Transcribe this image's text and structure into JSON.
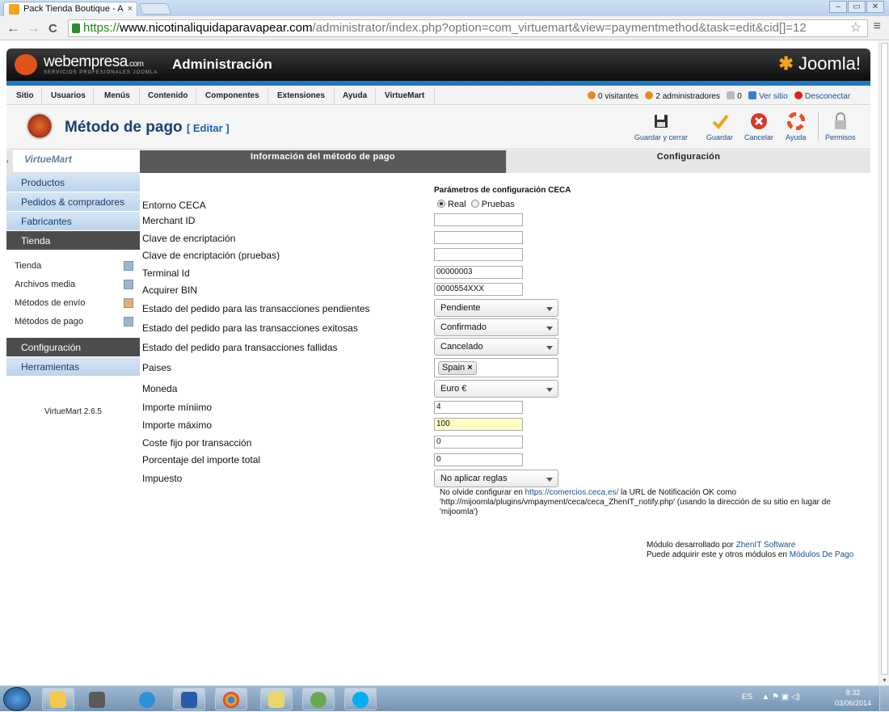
{
  "browser": {
    "tab_title": "Pack Tienda Boutique - A",
    "tab_close": "×",
    "url_scheme": "https://",
    "url_host": "www.nicotinaliquidaparavapear.com",
    "url_path": "/administrator/index.php?option=com_virtuemart&view=paymentmethod&task=edit&cid[]=12",
    "back": "←",
    "forward": "→",
    "reload": "C",
    "star": "☆",
    "menu": "≡",
    "win_min": "–",
    "win_max": "▭",
    "win_close": "✕"
  },
  "header": {
    "brand": "webempresa",
    "brand_suffix": ".com",
    "brand_sub": "SERVICIOS PROFESIONALES JOOMLA",
    "title": "Administración",
    "joomla_logo": "Joomla!"
  },
  "topmenu": {
    "items": [
      "Sitio",
      "Usuarios",
      "Menús",
      "Contenido",
      "Componentes",
      "Extensiones",
      "Ayuda",
      "VirtueMart"
    ],
    "visitors": "0 visitantes",
    "admins": "2 administradores",
    "messages": "0",
    "view_site": "Ver sitio",
    "logout": "Desconectar"
  },
  "toolbar": {
    "page_title": "Método de pago",
    "page_subtitle": "[ Editar ]",
    "buttons": [
      "Guardar y cerrar",
      "Guardar",
      "Cancelar",
      "Ayuda",
      "Permisos"
    ]
  },
  "sidebar": {
    "logo": "VirtueMart",
    "collapse": "‹",
    "sections": [
      "Productos",
      "Pedidos & compradores",
      "Fabricantes",
      "Tienda"
    ],
    "subitems": [
      "Tienda",
      "Archivos media",
      "Métodos de envío",
      "Métodos de pago"
    ],
    "bottom": [
      "Configuración",
      "Herramientas"
    ],
    "version": "VirtueMart 2.6.5"
  },
  "tabs": {
    "info": "Información del método de pago",
    "config": "Configuración"
  },
  "form": {
    "section_title": "Parámetros de configuración CECA",
    "labels": {
      "entorno": "Entorno CECA",
      "merchant": "Merchant ID",
      "clave": "Clave de encriptación",
      "clave_pruebas": "Clave de encriptación (pruebas)",
      "terminal": "Terminal Id",
      "acquirer": "Acquirer BIN",
      "estado_pend": "Estado del pedido para las transacciones pendientes",
      "estado_exit": "Estado del pedido para las transacciones exitosas",
      "estado_fall": "Estado del pedido para transacciones fallidas",
      "paises": "Paises",
      "moneda": "Moneda",
      "importe_min": "Importe míniimo",
      "importe_max": "Importe máximo",
      "coste_fijo": "Coste fijo por transacción",
      "porcentaje": "Porcentaje del importe total",
      "impuesto": "Impuesto"
    },
    "radio_real": "Real",
    "radio_pruebas": "Pruebas",
    "values": {
      "merchant": "",
      "clave": "",
      "clave_pruebas": "",
      "terminal": "00000003",
      "acquirer": "0000554XXX",
      "estado_pend": "Pendiente",
      "estado_exit": "Confirmado",
      "estado_fall": "Cancelado",
      "pais_chip": "Spain",
      "chip_remove": "×",
      "moneda": "Euro €",
      "importe_min": "4",
      "importe_max": "100",
      "coste_fijo": "0",
      "porcentaje": "0",
      "impuesto": "No aplicar reglas"
    },
    "note_prefix": "No olvide configurar en ",
    "note_link": "https://comercios.ceca.es/",
    "note_suffix": " la URL de Notificación OK como 'http://mijoomla/plugins/vmpayment/ceca/ceca_ZhenIT_notify.php' (usando la dirección de su sitio en lugar de 'mijoomla')",
    "credit_line1": "Módulo desarrollado por ",
    "credit_link1": "ZhenIT Software",
    "credit_line2": "Puede adquirir este y otros módulos en ",
    "credit_link2": "Módulos De Pago"
  },
  "taskbar": {
    "lang": "ES",
    "tray_icons": "▲  ⚑  ▣  ◁)",
    "time": "8:32",
    "date": "03/06/2014"
  },
  "colors": {
    "joomla_blue": "#1f78c1",
    "active_tab": "#595959",
    "highlight_input": "#ffffc2"
  }
}
